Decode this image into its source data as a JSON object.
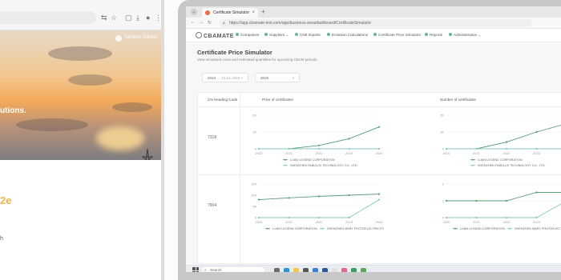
{
  "left_browser": {
    "contact_label": "Tandem Adress",
    "hero_text": "utions.",
    "accent_text": "2e",
    "small_text": "h"
  },
  "browser": {
    "tab_title": "Certificate Simulator",
    "new_tab_label": "+",
    "url": "https://app.cbamate-test.com/app/business-area/dashboard/CertificateSimulator"
  },
  "app": {
    "logo": "CBAMATE",
    "nav": [
      "Companies",
      "Suppliers",
      "CN8 Imports",
      "Emission Calculations",
      "Certificate Price Simulator",
      "Reports",
      "Administration"
    ]
  },
  "page": {
    "title": "Certificate Price Simulator",
    "subtitle": "View simulated costs and estimated quantities for upcoming CBAM periods",
    "filter1": {
      "left": "2024",
      "right": "01.01.2024",
      "sep": "→"
    },
    "filter2": "2026"
  },
  "table": {
    "headers": {
      "cn": "CN Heading Code",
      "price": "Price of certificates",
      "count": "Number of certificates"
    },
    "rows": [
      {
        "code": "7318"
      },
      {
        "code": "7604"
      }
    ]
  },
  "colors": {
    "line_primary": "#5a9a74",
    "line_secondary": "#86c7c6",
    "accent": "#f0b44a"
  },
  "chart_data": [
    {
      "type": "line",
      "x": [
        "2020",
        "2021",
        "2022",
        "2023",
        "2024"
      ],
      "ylim": [
        0,
        2000
      ],
      "y_ticks": [
        "0",
        "1K",
        "2K"
      ],
      "series": [
        {
          "name": "LUAN LEGEND CORPORATION",
          "values": [
            0,
            0,
            200,
            600,
            1300
          ]
        },
        {
          "name": "SHENZHEN FABULUX TECHNOLOGY CO., LTD.",
          "values": [
            0,
            0,
            0,
            0,
            0
          ]
        }
      ]
    },
    {
      "type": "line",
      "x": [
        "2020",
        "2021",
        "2022",
        "2023",
        "2024"
      ],
      "ylim": [
        0,
        20
      ],
      "y_ticks": [
        "0",
        "1K",
        "2K"
      ],
      "series": [
        {
          "name": "LUAN LEGEND CORPORATION",
          "values": [
            0,
            0,
            4,
            10,
            15
          ]
        },
        {
          "name": "SHENZHEN FABULUX TECHNOLOGY CO., LTD.",
          "values": [
            0,
            0,
            0,
            0,
            0
          ]
        }
      ]
    },
    {
      "type": "line",
      "x": [
        "2020",
        "2021",
        "2022",
        "2023",
        "2024"
      ],
      "ylim": [
        0,
        150
      ],
      "y_ticks": [
        "0",
        "50",
        "100",
        "150"
      ],
      "series": [
        {
          "name": "LUAN LEGEND CORPORATION",
          "values": [
            80,
            88,
            95,
            100,
            105
          ]
        },
        {
          "name": "SHENZHEN MARY PHOTOELECTRICITY",
          "values": [
            0,
            0,
            0,
            0,
            80
          ]
        }
      ]
    },
    {
      "type": "line",
      "x": [
        "2020",
        "2021",
        "2022",
        "2023",
        "2024"
      ],
      "ylim": [
        0,
        2
      ],
      "y_ticks": [
        "0",
        "1",
        "2"
      ],
      "series": [
        {
          "name": "LUAN LEGEND CORPORATION",
          "values": [
            1,
            1,
            1,
            1.5,
            1.5
          ]
        },
        {
          "name": "SHENZHEN MARY PHOTOELECTRICITY",
          "values": [
            0,
            0,
            0,
            0,
            1
          ]
        }
      ]
    }
  ],
  "taskbar": {
    "search_label": "Search"
  }
}
